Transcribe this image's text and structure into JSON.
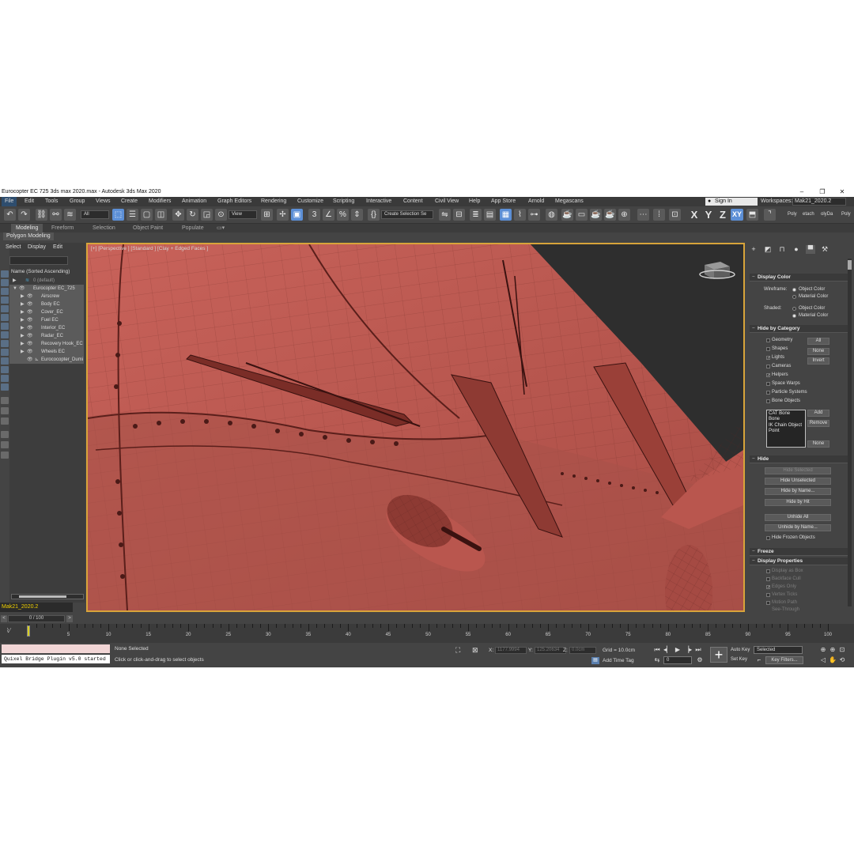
{
  "window": {
    "title": "Eurocopter EC 725 3ds max 2020.max - Autodesk 3ds Max 2020",
    "minimize": "–",
    "restore": "❐",
    "close": "✕"
  },
  "menu": {
    "items": [
      "File",
      "Edit",
      "Tools",
      "Group",
      "Views",
      "Create",
      "Modifiers",
      "Animation",
      "Graph Editors",
      "Rendering",
      "Customize",
      "Scripting",
      "Interactive",
      "Content",
      "Civil View",
      "Help",
      "App Store",
      "Arnold",
      "Megascans"
    ],
    "sign_in": "Sign In",
    "workspaces_label": "Workspaces:",
    "workspace_value": "Mak21_2020.2"
  },
  "toolbar": {
    "selection_filter": "All",
    "ref_coord": "View",
    "named_selection": "Create Selection Se",
    "axis_x": "X",
    "axis_y": "Y",
    "axis_z": "Z",
    "axis_xy": "XY",
    "extra": [
      "Poly",
      "etach",
      "olyDa",
      "Poly"
    ]
  },
  "ribbon": {
    "tabs": [
      "Modeling",
      "Freeform",
      "Selection",
      "Object Paint",
      "Populate"
    ],
    "sub_label": "Polygon Modeling"
  },
  "scene_explorer": {
    "tabs": [
      "Select",
      "Display",
      "Edit"
    ],
    "header": "Name (Sorted Ascending)",
    "layer_default": "0 (default)",
    "root": "Eurocopter EC_725",
    "children": [
      "Airscrew",
      "Body EC",
      "Cover_EC",
      "Fuel EC",
      "Interior_EC",
      "Radar_EC",
      "Recovery Hook_EC",
      "Wheels EC",
      "Eurococopter_Dumi"
    ],
    "layer_bar": "Mak21_2020.2"
  },
  "viewport": {
    "label": "[+] [Perspective ] [Standard ] [Clay + Edged Faces ]"
  },
  "command_panel": {
    "display_color": {
      "title": "Display Color",
      "wireframe_label": "Wireframe:",
      "shaded_label": "Shaded:",
      "object_color": "Object Color",
      "material_color": "Material Color"
    },
    "hide_by_category": {
      "title": "Hide by Category",
      "items": [
        "Geometry",
        "Shapes",
        "Lights",
        "Cameras",
        "Helpers",
        "Space Warps",
        "Particle Systems",
        "Bone Objects"
      ],
      "checked": [
        false,
        false,
        true,
        false,
        true,
        false,
        false,
        false
      ],
      "btn_all": "All",
      "btn_none": "None",
      "btn_invert": "Invert",
      "list": [
        "CAT Bone",
        "Bone",
        "IK Chain Object",
        "Point"
      ],
      "btn_add": "Add",
      "btn_remove": "Remove",
      "btn_none2": "None"
    },
    "hide": {
      "title": "Hide",
      "buttons": [
        "Hide Selected",
        "Hide Unselected",
        "Hide by Name...",
        "Hide by Hit",
        "Unhide All",
        "Unhide by Name..."
      ],
      "frozen": "Hide Frozen Objects"
    },
    "freeze": {
      "title": "Freeze"
    },
    "display_properties": {
      "title": "Display Properties",
      "items": [
        "Display as Box",
        "Backface Cull",
        "Edges Only",
        "Vertex Ticks",
        "Motion Path",
        "See-Through"
      ]
    }
  },
  "timeline": {
    "frame_display": "0 / 100",
    "ticks": [
      "0",
      "5",
      "10",
      "15",
      "20",
      "25",
      "30",
      "35",
      "40",
      "45",
      "50",
      "55",
      "60",
      "65",
      "70",
      "75",
      "80",
      "85",
      "90",
      "95",
      "100"
    ]
  },
  "status": {
    "maxscript_output": "Quixel Bridge Plugin v5.0 started",
    "selection": "None Selected",
    "prompt": "Click or click-and-drag to select objects",
    "x_label": "X:",
    "x_value": "1177.9994",
    "y_label": "Y:",
    "y_value": "125.20634",
    "z_label": "Z:",
    "z_value": "0.0cm",
    "grid": "Grid = 10.0cm",
    "add_time_tag": "Add Time Tag",
    "auto_key": "Auto Key",
    "set_key": "Set Key",
    "key_mode": "Selected",
    "key_filters": "Key Filters...",
    "frame_field": "0"
  }
}
